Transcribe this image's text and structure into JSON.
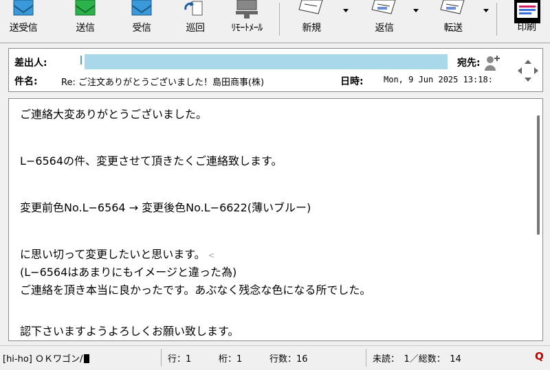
{
  "toolbar": {
    "send_receive": "送受信",
    "send": "送信",
    "receive": "受信",
    "patrol": "巡回",
    "remote_mail": "ﾘﾓｰﾄﾒｰﾙ",
    "new": "新規",
    "reply": "返信",
    "forward": "転送",
    "print": "印刷"
  },
  "header": {
    "from_label": "差出人:",
    "to_label": "宛先:",
    "subject_label": "件名:",
    "subject_value": "Re: ご注文ありがとうございました！島田商事(株)",
    "date_label": "日時:",
    "date_value": "Mon, 9 Jun 2025 13:18:"
  },
  "body": {
    "lines": [
      "ご連絡大変ありがとうございました。",
      "L−6564の件、変更させて頂きたくご連絡致します。",
      "変更前色No.L−6564 → 変更後色No.L−6622(薄いブルー)",
      "に思い切って変更したいと思います。",
      "(L−6564はあまりにもイメージと違った為)",
      "ご連絡を頂き本当に良かったです。あぶなく残念な色になる所でした。",
      "認下さいますようよろしくお願い致します。"
    ],
    "caret": "<"
  },
  "status": {
    "account": "[hi-ho] ＯＫワゴン/",
    "row": "行：1",
    "col": "桁：1",
    "lines": "行数：16",
    "unread": "未読：　1／総数：　14",
    "q": "Q"
  }
}
